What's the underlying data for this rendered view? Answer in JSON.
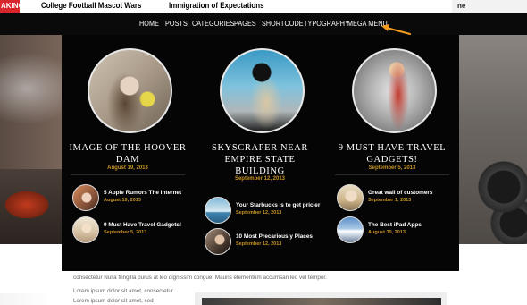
{
  "ticker": {
    "tag": "AKING",
    "items": [
      "College Football Mascot Wars",
      "Immigration of Expectations"
    ],
    "right_text": "ne"
  },
  "nav": {
    "items": [
      "HOME",
      "POSTS",
      "CATEGORIES",
      "PAGES",
      "SHORTCODE",
      "TYPOGRAPHY",
      "MEGA MENU"
    ],
    "arrow_color": "#f39a21"
  },
  "mega_menu": {
    "columns": [
      {
        "featured": {
          "title_lines": [
            "IMAGE OF THE HOOVER",
            "DAM"
          ],
          "date": "August 19, 2013"
        },
        "posts": [
          {
            "title": "5 Apple Rumors The Internet",
            "date": "August 19, 2013"
          },
          {
            "title": "9 Must Have Travel Gadgets!",
            "date": "September 5, 2013"
          }
        ]
      },
      {
        "featured": {
          "title_lines": [
            "SKYSCRAPER NEAR",
            "EMPIRE STATE",
            "BUILDING"
          ],
          "date": "September 12, 2013"
        },
        "posts": [
          {
            "title": "Your Starbucks is to get pricier",
            "date": "September 12, 2013"
          },
          {
            "title": "10 Most Precariously Places",
            "date": "September 12, 2013"
          }
        ]
      },
      {
        "featured": {
          "title_lines": [
            "9 MUST HAVE TRAVEL",
            "GADGETS!"
          ],
          "date": "September 5, 2013"
        },
        "posts": [
          {
            "title": "Great wall of customers",
            "date": "September 1, 2013"
          },
          {
            "title": "The Best iPad Apps",
            "date": "August 30, 2013"
          }
        ]
      }
    ]
  },
  "body": {
    "line1": "consectetur Nulla fringilla purus at leo dignissim congue. Mauris elementum accumsan leo vel tempor.",
    "line2": "Lorem ipsum dolor sit amet, consectetur",
    "line3": "Lorem ipsum dolor sit amet, sed"
  },
  "colors": {
    "accent": "#c79424",
    "ticker_tag": "#d8262c",
    "nav_bg": "#0a0a0a"
  }
}
